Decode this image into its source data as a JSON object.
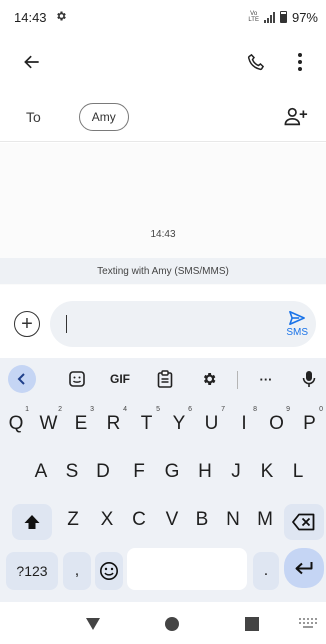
{
  "status_bar": {
    "time": "14:43",
    "network_top": "Vo",
    "network_bottom": "LTE",
    "battery": "97%",
    "icons": [
      "gear-icon",
      "signal-icon",
      "battery-icon"
    ]
  },
  "top_bar": {
    "icons": [
      "back-arrow-icon",
      "phone-icon",
      "more-vert-icon"
    ]
  },
  "recipient": {
    "label": "To",
    "chip": "Amy",
    "add_icon": "add-person-icon"
  },
  "conversation": {
    "timestamp": "14:43",
    "info": "Texting with Amy (SMS/MMS)"
  },
  "compose": {
    "value": "",
    "send_label": "SMS",
    "accent": "#1a73e8"
  },
  "keyboard": {
    "toolbar": {
      "gif_label": "GIF",
      "more_label": "···",
      "icons": [
        "chevron-left-icon",
        "sticker-icon",
        "clipboard-icon",
        "gear-icon",
        "mic-icon"
      ]
    },
    "row1": [
      {
        "label": "Q",
        "hint": "1"
      },
      {
        "label": "W",
        "hint": "2"
      },
      {
        "label": "E",
        "hint": "3"
      },
      {
        "label": "R",
        "hint": "4"
      },
      {
        "label": "T",
        "hint": "5"
      },
      {
        "label": "Y",
        "hint": "6"
      },
      {
        "label": "U",
        "hint": "7"
      },
      {
        "label": "I",
        "hint": "8"
      },
      {
        "label": "O",
        "hint": "9"
      },
      {
        "label": "P",
        "hint": "0"
      }
    ],
    "row2": [
      "A",
      "S",
      "D",
      "F",
      "G",
      "H",
      "J",
      "K",
      "L"
    ],
    "row3": [
      "Z",
      "X",
      "C",
      "V",
      "B",
      "N",
      "M"
    ],
    "row4": {
      "symbols_label": "?123",
      "comma": ",",
      "period": ".",
      "emoji_icon": "emoji-icon",
      "enter_icon": "enter-icon"
    },
    "colors": {
      "background": "#eef1f6",
      "special_key": "#dfe6f2",
      "accent_key": "#c5d5f4"
    }
  },
  "nav_bar": {
    "icons": [
      "back-triangle-icon",
      "home-circle-icon",
      "recents-square-icon",
      "keyboard-icon"
    ]
  }
}
